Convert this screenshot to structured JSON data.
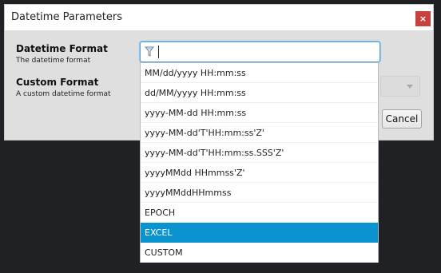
{
  "dialog": {
    "title": "Datetime Parameters",
    "close_label": "×"
  },
  "fields": {
    "datetime_format": {
      "label": "Datetime Format",
      "help": "The datetime format",
      "search_value": ""
    },
    "custom_format": {
      "label": "Custom Format",
      "help": "A custom datetime format"
    }
  },
  "buttons": {
    "cancel": "Cancel"
  },
  "dropdown": {
    "selected_index": 8,
    "options": [
      "MM/dd/yyyy HH:mm:ss",
      "dd/MM/yyyy HH:mm:ss",
      "yyyy-MM-dd HH:mm:ss",
      "yyyy-MM-dd'T'HH:mm:ss'Z'",
      "yyyy-MM-dd'T'HH:mm:ss.SSS'Z'",
      "yyyyMMdd HHmmss'Z'",
      "yyyyMMddHHmmss",
      "EPOCH",
      "EXCEL",
      "CUSTOM"
    ]
  },
  "icons": {
    "filter": "filter-icon",
    "close": "close-icon",
    "dropdown_arrow": "chevron-down-icon"
  }
}
